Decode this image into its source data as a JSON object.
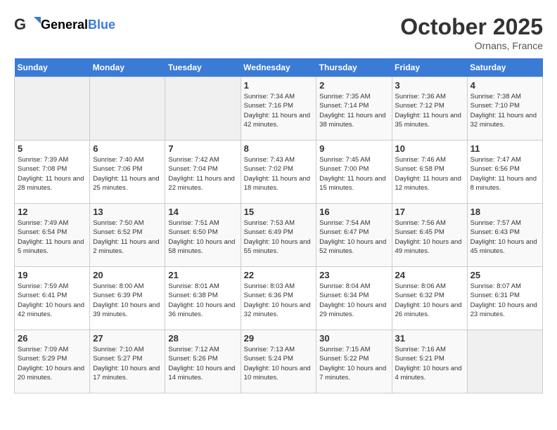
{
  "header": {
    "logo_general": "General",
    "logo_blue": "Blue",
    "month": "October 2025",
    "location": "Ornans, France"
  },
  "days_of_week": [
    "Sunday",
    "Monday",
    "Tuesday",
    "Wednesday",
    "Thursday",
    "Friday",
    "Saturday"
  ],
  "weeks": [
    [
      {
        "day": "",
        "info": ""
      },
      {
        "day": "",
        "info": ""
      },
      {
        "day": "",
        "info": ""
      },
      {
        "day": "1",
        "info": "Sunrise: 7:34 AM\nSunset: 7:16 PM\nDaylight: 11 hours and 42 minutes."
      },
      {
        "day": "2",
        "info": "Sunrise: 7:35 AM\nSunset: 7:14 PM\nDaylight: 11 hours and 38 minutes."
      },
      {
        "day": "3",
        "info": "Sunrise: 7:36 AM\nSunset: 7:12 PM\nDaylight: 11 hours and 35 minutes."
      },
      {
        "day": "4",
        "info": "Sunrise: 7:38 AM\nSunset: 7:10 PM\nDaylight: 11 hours and 32 minutes."
      }
    ],
    [
      {
        "day": "5",
        "info": "Sunrise: 7:39 AM\nSunset: 7:08 PM\nDaylight: 11 hours and 28 minutes."
      },
      {
        "day": "6",
        "info": "Sunrise: 7:40 AM\nSunset: 7:06 PM\nDaylight: 11 hours and 25 minutes."
      },
      {
        "day": "7",
        "info": "Sunrise: 7:42 AM\nSunset: 7:04 PM\nDaylight: 11 hours and 22 minutes."
      },
      {
        "day": "8",
        "info": "Sunrise: 7:43 AM\nSunset: 7:02 PM\nDaylight: 11 hours and 18 minutes."
      },
      {
        "day": "9",
        "info": "Sunrise: 7:45 AM\nSunset: 7:00 PM\nDaylight: 11 hours and 15 minutes."
      },
      {
        "day": "10",
        "info": "Sunrise: 7:46 AM\nSunset: 6:58 PM\nDaylight: 11 hours and 12 minutes."
      },
      {
        "day": "11",
        "info": "Sunrise: 7:47 AM\nSunset: 6:56 PM\nDaylight: 11 hours and 8 minutes."
      }
    ],
    [
      {
        "day": "12",
        "info": "Sunrise: 7:49 AM\nSunset: 6:54 PM\nDaylight: 11 hours and 5 minutes."
      },
      {
        "day": "13",
        "info": "Sunrise: 7:50 AM\nSunset: 6:52 PM\nDaylight: 11 hours and 2 minutes."
      },
      {
        "day": "14",
        "info": "Sunrise: 7:51 AM\nSunset: 6:50 PM\nDaylight: 10 hours and 58 minutes."
      },
      {
        "day": "15",
        "info": "Sunrise: 7:53 AM\nSunset: 6:49 PM\nDaylight: 10 hours and 55 minutes."
      },
      {
        "day": "16",
        "info": "Sunrise: 7:54 AM\nSunset: 6:47 PM\nDaylight: 10 hours and 52 minutes."
      },
      {
        "day": "17",
        "info": "Sunrise: 7:56 AM\nSunset: 6:45 PM\nDaylight: 10 hours and 49 minutes."
      },
      {
        "day": "18",
        "info": "Sunrise: 7:57 AM\nSunset: 6:43 PM\nDaylight: 10 hours and 45 minutes."
      }
    ],
    [
      {
        "day": "19",
        "info": "Sunrise: 7:59 AM\nSunset: 6:41 PM\nDaylight: 10 hours and 42 minutes."
      },
      {
        "day": "20",
        "info": "Sunrise: 8:00 AM\nSunset: 6:39 PM\nDaylight: 10 hours and 39 minutes."
      },
      {
        "day": "21",
        "info": "Sunrise: 8:01 AM\nSunset: 6:38 PM\nDaylight: 10 hours and 36 minutes."
      },
      {
        "day": "22",
        "info": "Sunrise: 8:03 AM\nSunset: 6:36 PM\nDaylight: 10 hours and 32 minutes."
      },
      {
        "day": "23",
        "info": "Sunrise: 8:04 AM\nSunset: 6:34 PM\nDaylight: 10 hours and 29 minutes."
      },
      {
        "day": "24",
        "info": "Sunrise: 8:06 AM\nSunset: 6:32 PM\nDaylight: 10 hours and 26 minutes."
      },
      {
        "day": "25",
        "info": "Sunrise: 8:07 AM\nSunset: 6:31 PM\nDaylight: 10 hours and 23 minutes."
      }
    ],
    [
      {
        "day": "26",
        "info": "Sunrise: 7:09 AM\nSunset: 5:29 PM\nDaylight: 10 hours and 20 minutes."
      },
      {
        "day": "27",
        "info": "Sunrise: 7:10 AM\nSunset: 5:27 PM\nDaylight: 10 hours and 17 minutes."
      },
      {
        "day": "28",
        "info": "Sunrise: 7:12 AM\nSunset: 5:26 PM\nDaylight: 10 hours and 14 minutes."
      },
      {
        "day": "29",
        "info": "Sunrise: 7:13 AM\nSunset: 5:24 PM\nDaylight: 10 hours and 10 minutes."
      },
      {
        "day": "30",
        "info": "Sunrise: 7:15 AM\nSunset: 5:22 PM\nDaylight: 10 hours and 7 minutes."
      },
      {
        "day": "31",
        "info": "Sunrise: 7:16 AM\nSunset: 5:21 PM\nDaylight: 10 hours and 4 minutes."
      },
      {
        "day": "",
        "info": ""
      }
    ]
  ]
}
